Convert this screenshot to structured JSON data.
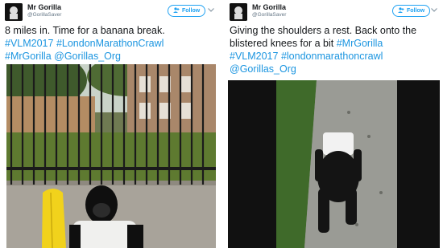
{
  "tweets": [
    {
      "display_name": "Mr Gorilla",
      "handle": "@GorillaSaver",
      "follow_label": "Follow",
      "text_line1": "8 miles in. Time for a banana break.",
      "hashtags_line2": [
        "#VLM2017",
        "#LondonMarathonCrawl"
      ],
      "tags_line3": [
        "#MrGorilla",
        "@Gorillas_Org"
      ]
    },
    {
      "display_name": "Mr Gorilla",
      "handle": "@GorillaSaver",
      "follow_label": "Follow",
      "text_line1": "Giving the shoulders a rest. Back onto the",
      "text_line2": "blistered knees for a bit",
      "tag_line2": "#MrGorilla",
      "hashtags_line3": [
        "#VLM2017",
        "#londonmarathoncrawl"
      ],
      "tags_line4": [
        "@Gorillas_Org"
      ]
    }
  ],
  "icons": {
    "follow": "add-user-icon",
    "caret": "chevron-down-icon"
  },
  "colors": {
    "link": "#1b95e0",
    "follow_accent": "#1da1f2",
    "handle_gray": "#657786"
  }
}
